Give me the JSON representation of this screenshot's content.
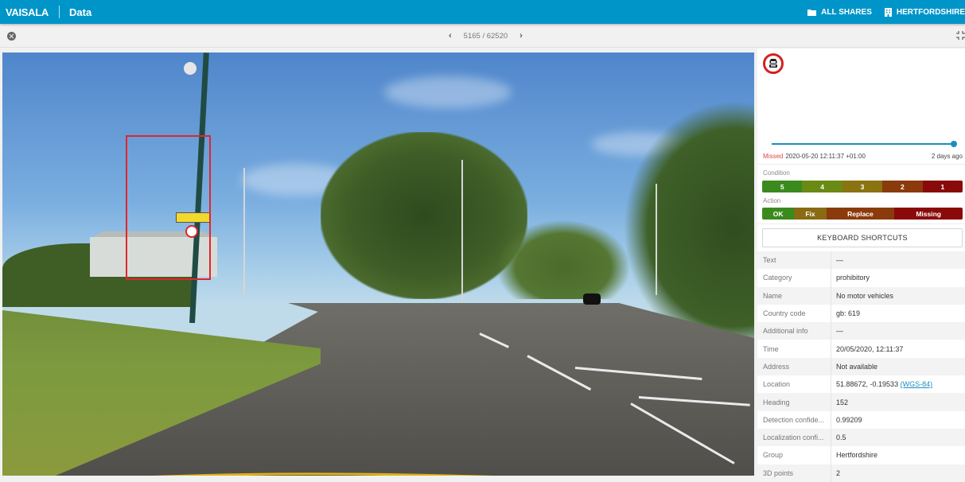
{
  "header": {
    "brand": "VAISALA",
    "section": "Data",
    "links": [
      {
        "label": "ALL SHARES",
        "icon": "folder-icon"
      },
      {
        "label": "HERTFORDSHIRE",
        "icon": "building-icon"
      }
    ]
  },
  "toolbar": {
    "close_icon": "close-circle-icon",
    "prev_icon": "‹",
    "next_icon": "›",
    "counter": "5165 / 62520",
    "fullscreen_icon": "exit-fullscreen-icon"
  },
  "viewer": {
    "image_description": "Dashcam road photo with red bounding box around sign",
    "bbox_color": "#e0262b"
  },
  "detail": {
    "sign_icon": "no-motor-vehicles-sign-icon",
    "timeline_progress": 1.0,
    "status": "Missed",
    "status_color": "#e14646",
    "timestamp": "2020-05-20 12:11:37 +01:00",
    "relative_time": "2 days ago",
    "condition_label": "Condition",
    "condition": [
      {
        "label": "5",
        "color": "#3b8a1e"
      },
      {
        "label": "4",
        "color": "#6a8a14"
      },
      {
        "label": "3",
        "color": "#8a7412"
      },
      {
        "label": "2",
        "color": "#8b3a0c"
      },
      {
        "label": "1",
        "color": "#8a0a0a"
      }
    ],
    "action_label": "Action",
    "action": [
      {
        "label": "OK",
        "color": "#3b8a1e"
      },
      {
        "label": "Fix",
        "color": "#8a6a12"
      },
      {
        "label": "Replace",
        "color": "#8b3a0c"
      },
      {
        "label": "Missing",
        "color": "#8a0a0a"
      }
    ],
    "keyboard_button": "KEYBOARD SHORTCUTS",
    "properties": [
      {
        "key": "Text",
        "value": "—"
      },
      {
        "key": "Category",
        "value": "prohibitory"
      },
      {
        "key": "Name",
        "value": "No motor vehicles"
      },
      {
        "key": "Country code",
        "value": "gb: 619"
      },
      {
        "key": "Additional info",
        "value": "—"
      },
      {
        "key": "Time",
        "value": "20/05/2020, 12:11:37"
      },
      {
        "key": "Address",
        "value": "Not available"
      },
      {
        "key": "Location",
        "value": "51.88672, -0.19533",
        "link": "(WGS-84)"
      },
      {
        "key": "Heading",
        "value": "152"
      },
      {
        "key": "Detection confide...",
        "value": "0.99209"
      },
      {
        "key": "Localization confi...",
        "value": "0.5"
      },
      {
        "key": "Group",
        "value": "Hertfordshire"
      },
      {
        "key": "3D points",
        "value": "2"
      }
    ]
  }
}
